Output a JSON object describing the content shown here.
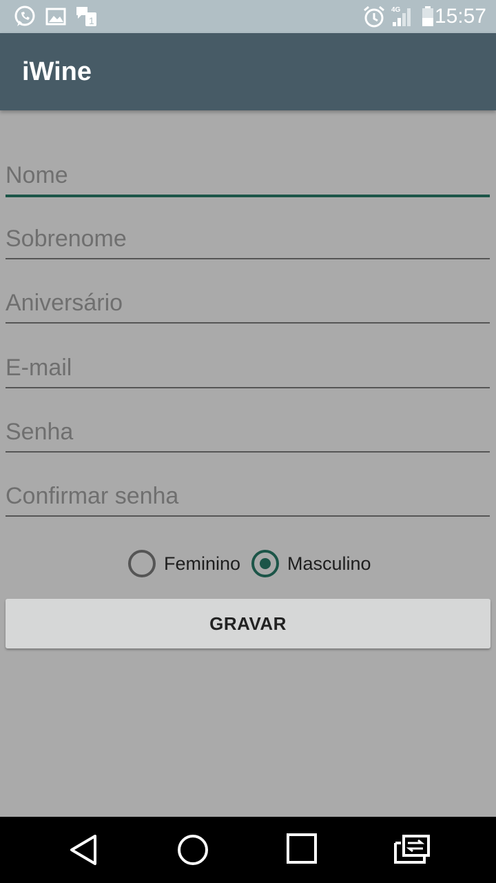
{
  "status_bar": {
    "time": "15:57",
    "network": "4G",
    "icons": [
      "whatsapp-icon",
      "gallery-icon",
      "notification-icon",
      "alarm-icon",
      "signal-icon",
      "battery-icon"
    ]
  },
  "app_bar": {
    "title": "iWine"
  },
  "form": {
    "fields": [
      {
        "placeholder": "Nome",
        "value": ""
      },
      {
        "placeholder": "Sobrenome",
        "value": ""
      },
      {
        "placeholder": "Aniversário",
        "value": ""
      },
      {
        "placeholder": "E-mail",
        "value": ""
      },
      {
        "placeholder": "Senha",
        "value": ""
      },
      {
        "placeholder": "Confirmar senha",
        "value": ""
      }
    ],
    "gender": {
      "options": [
        "Feminino",
        "Masculino"
      ],
      "selected": "Masculino"
    },
    "save_label": "GRAVAR"
  },
  "nav_bar": {
    "icons": [
      "back-icon",
      "home-icon",
      "recents-icon",
      "switch-app-icon"
    ]
  },
  "colors": {
    "background": "#aaaaaa",
    "app_bar": "#475b66",
    "status_bar": "#b1bfc5",
    "accent": "#1c5548",
    "button": "#d6d7d7"
  }
}
